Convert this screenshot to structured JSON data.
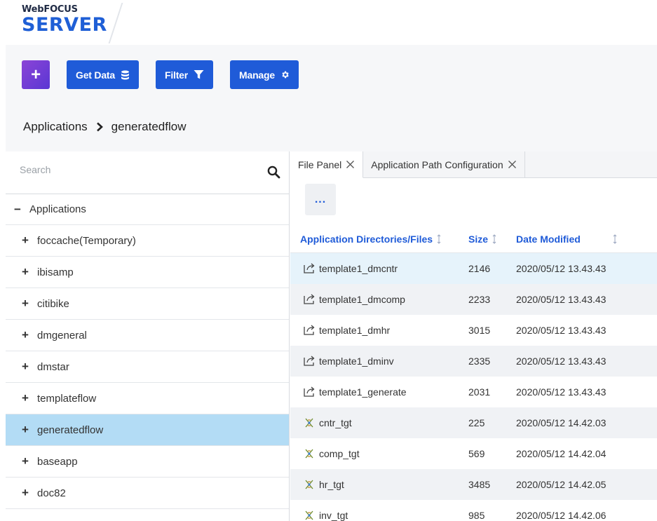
{
  "brand": {
    "top": "WebFOCUS",
    "main": "SERVER"
  },
  "toolbar": {
    "add_label": "+",
    "get_data_label": "Get Data",
    "filter_label": "Filter",
    "manage_label": "Manage"
  },
  "breadcrumb": {
    "root": "Applications",
    "current": "generatedflow"
  },
  "search": {
    "placeholder": "Search"
  },
  "tree": {
    "root": {
      "sign": "−",
      "label": "Applications"
    },
    "items": [
      {
        "sign": "+",
        "label": "foccache(Temporary)"
      },
      {
        "sign": "+",
        "label": "ibisamp"
      },
      {
        "sign": "+",
        "label": "citibike"
      },
      {
        "sign": "+",
        "label": "dmgeneral"
      },
      {
        "sign": "+",
        "label": "dmstar"
      },
      {
        "sign": "+",
        "label": "templateflow"
      },
      {
        "sign": "+",
        "label": "generatedflow"
      },
      {
        "sign": "+",
        "label": "baseapp"
      },
      {
        "sign": "+",
        "label": "doc82"
      }
    ],
    "selected": "generatedflow"
  },
  "tabs": [
    {
      "label": "File Panel"
    },
    {
      "label": "Application Path Configuration"
    }
  ],
  "more_button": "...",
  "table": {
    "headers": [
      "Application Directories/Files",
      "Size",
      "Date Modified"
    ],
    "rows": [
      {
        "icon": "flow-icon",
        "name": "template1_dmcntr",
        "size": "2146",
        "date": "2020/05/12 13.43.43"
      },
      {
        "icon": "flow-icon",
        "name": "template1_dmcomp",
        "size": "2233",
        "date": "2020/05/12 13.43.43"
      },
      {
        "icon": "flow-icon",
        "name": "template1_dmhr",
        "size": "3015",
        "date": "2020/05/12 13.43.43"
      },
      {
        "icon": "flow-icon",
        "name": "template1_dminv",
        "size": "2335",
        "date": "2020/05/12 13.43.43"
      },
      {
        "icon": "flow-icon",
        "name": "template1_generate",
        "size": "2031",
        "date": "2020/05/12 13.43.43"
      },
      {
        "icon": "synonym-icon",
        "name": "cntr_tgt",
        "size": "225",
        "date": "2020/05/12 14.42.03"
      },
      {
        "icon": "synonym-icon",
        "name": "comp_tgt",
        "size": "569",
        "date": "2020/05/12 14.42.04"
      },
      {
        "icon": "synonym-icon",
        "name": "hr_tgt",
        "size": "3485",
        "date": "2020/05/12 14.42.05"
      },
      {
        "icon": "synonym-icon",
        "name": "inv_tgt",
        "size": "985",
        "date": "2020/05/12 14.42.06"
      }
    ]
  },
  "colors": {
    "accent": "#1f5bd8",
    "brand": "#1f5fd6",
    "selected": "#b3dcf5"
  }
}
